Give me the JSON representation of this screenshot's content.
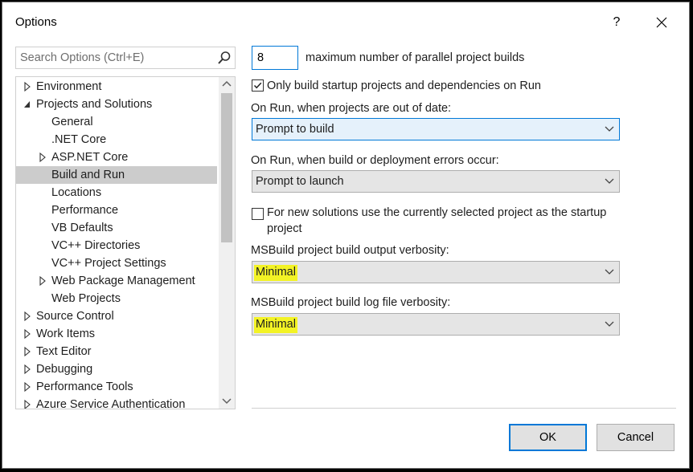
{
  "window": {
    "title": "Options",
    "help_label": "?"
  },
  "search": {
    "placeholder": "Search Options (Ctrl+E)"
  },
  "tree": {
    "items": [
      {
        "label": "Environment",
        "level": 0,
        "expander": "collapsed"
      },
      {
        "label": "Projects and Solutions",
        "level": 0,
        "expander": "expanded"
      },
      {
        "label": "General",
        "level": 1,
        "expander": "none"
      },
      {
        "label": ".NET Core",
        "level": 1,
        "expander": "none"
      },
      {
        "label": "ASP.NET Core",
        "level": 1,
        "expander": "collapsed"
      },
      {
        "label": "Build and Run",
        "level": 1,
        "expander": "none",
        "selected": true
      },
      {
        "label": "Locations",
        "level": 1,
        "expander": "none"
      },
      {
        "label": "Performance",
        "level": 1,
        "expander": "none"
      },
      {
        "label": "VB Defaults",
        "level": 1,
        "expander": "none"
      },
      {
        "label": "VC++ Directories",
        "level": 1,
        "expander": "none"
      },
      {
        "label": "VC++ Project Settings",
        "level": 1,
        "expander": "none"
      },
      {
        "label": "Web Package Management",
        "level": 1,
        "expander": "collapsed"
      },
      {
        "label": "Web Projects",
        "level": 1,
        "expander": "none"
      },
      {
        "label": "Source Control",
        "level": 0,
        "expander": "collapsed"
      },
      {
        "label": "Work Items",
        "level": 0,
        "expander": "collapsed"
      },
      {
        "label": "Text Editor",
        "level": 0,
        "expander": "collapsed"
      },
      {
        "label": "Debugging",
        "level": 0,
        "expander": "collapsed"
      },
      {
        "label": "Performance Tools",
        "level": 0,
        "expander": "collapsed"
      },
      {
        "label": "Azure Service Authentication",
        "level": 0,
        "expander": "collapsed"
      }
    ]
  },
  "settings": {
    "parallel_builds_value": "8",
    "parallel_builds_label": "maximum number of parallel project builds",
    "only_build_startup_label": "Only build startup projects and dependencies on Run",
    "only_build_startup_checked": true,
    "out_of_date_label": "On Run, when projects are out of date:",
    "out_of_date_value": "Prompt to build",
    "errors_label": "On Run, when build or deployment errors occur:",
    "errors_value": "Prompt to launch",
    "new_solutions_label_line1": "For new solutions use the currently selected project as the startup",
    "new_solutions_label_line2": "project",
    "new_solutions_checked": false,
    "output_verbosity_label": "MSBuild project build output verbosity:",
    "output_verbosity_value": "Minimal",
    "log_verbosity_label": "MSBuild project build log file verbosity:",
    "log_verbosity_value": "Minimal",
    "highlight_color": "#f3f325"
  },
  "buttons": {
    "ok": "OK",
    "cancel": "Cancel"
  },
  "colors": {
    "accent": "#0078d7",
    "selected_row": "#cccccc"
  }
}
